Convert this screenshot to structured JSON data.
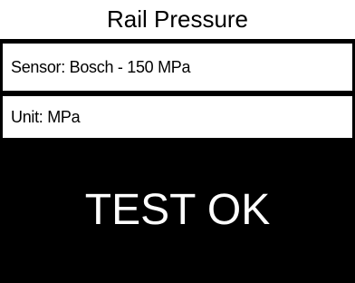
{
  "header": {
    "title": "Rail Pressure"
  },
  "fields": {
    "sensor": "Sensor: Bosch - 150 MPa",
    "unit": "Unit: MPa"
  },
  "result": {
    "status": "TEST OK"
  },
  "colors": {
    "background": "#000000",
    "panel": "#ffffff",
    "result_text": "#ffffff"
  }
}
